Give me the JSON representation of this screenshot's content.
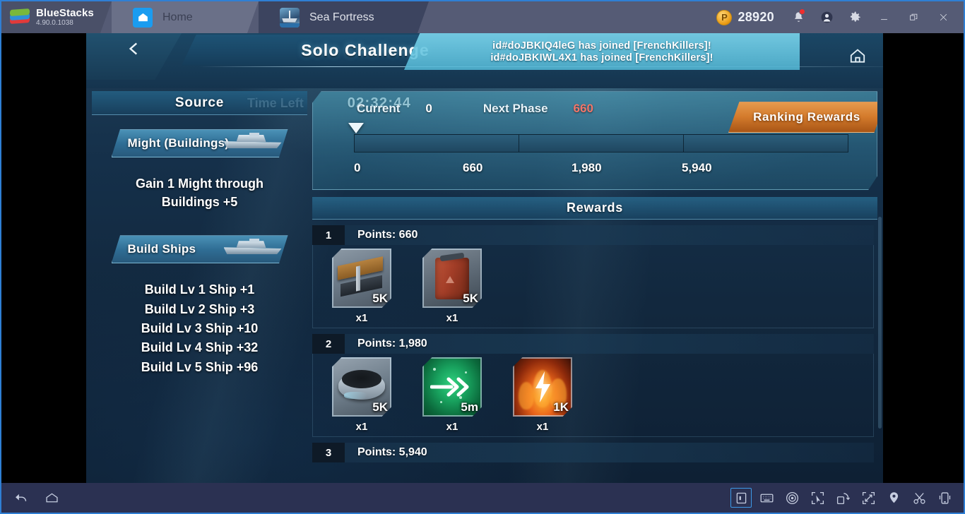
{
  "titlebar": {
    "brand_name": "BlueStacks",
    "brand_version": "4.90.0.1038",
    "tabs": [
      {
        "label": "Home",
        "icon": "home-icon"
      },
      {
        "label": "Sea Fortress",
        "icon": "game-icon"
      }
    ],
    "points_symbol": "P",
    "points_value": "28920",
    "buttons": [
      "notifications-bell",
      "user-avatar",
      "settings-gear",
      "minimize",
      "restore",
      "close"
    ]
  },
  "game": {
    "header": {
      "back_icon": "back-chevron-icon",
      "title": "Solo Challenge",
      "time_left_label": "Time Left",
      "time_left_value": "02:32:44",
      "home_icon": "home-icon",
      "chat": [
        "id#doJBKIQ4leG has joined [FrenchKillers]!",
        "id#doJBKIWL4X1 has joined [FrenchKillers]!"
      ]
    },
    "source": {
      "header": "Source",
      "sections": [
        {
          "tab_label": "Might (Buildings)",
          "lines": [
            "Gain 1 Might through",
            "Buildings +5"
          ]
        },
        {
          "tab_label": "Build Ships",
          "lines": [
            "Build Lv 1 Ship +1",
            "Build Lv 2 Ship +3",
            "Build Lv 3 Ship +10",
            "Build Lv 4 Ship +32",
            "Build Lv 5 Ship +96"
          ]
        }
      ]
    },
    "progress": {
      "current_label": "Current",
      "current_value": "0",
      "next_phase_label": "Next Phase",
      "next_phase_value": "660",
      "next_phase_color": "#f2766a",
      "ticks": [
        "0",
        "660",
        "1,980",
        "5,940"
      ],
      "marker_percent": 0
    },
    "ranking_button": "Ranking Rewards",
    "rewards": {
      "header": "Rewards",
      "tiers": [
        {
          "number": "1",
          "points_label": "Points: 660",
          "items": [
            {
              "art": "steel",
              "qty_badge": "5K",
              "count": "x1",
              "icon": "steel-beam-icon"
            },
            {
              "art": "fuel",
              "qty_badge": "5K",
              "count": "x1",
              "icon": "fuel-canister-icon"
            }
          ]
        },
        {
          "number": "2",
          "points_label": "Points: 1,980",
          "items": [
            {
              "art": "titan",
              "qty_badge": "5K",
              "count": "x1",
              "icon": "titanium-icon"
            },
            {
              "art": "speed",
              "qty_badge": "5m",
              "count": "x1",
              "icon": "speedup-arrows-icon"
            },
            {
              "art": "fire",
              "qty_badge": "1K",
              "count": "x1",
              "icon": "energy-flame-icon"
            }
          ]
        },
        {
          "number": "3",
          "points_label": "Points: 5,940",
          "items": []
        }
      ]
    }
  },
  "bottombar": {
    "left": [
      "back-icon",
      "home-icon"
    ],
    "right": [
      "sidebar-toggle-icon",
      "keyboard-icon",
      "eye-macro-icon",
      "pointer-select-icon",
      "rotate-screen-icon",
      "fullscreen-icon",
      "location-pin-icon",
      "scissors-cut-icon",
      "shake-device-icon"
    ]
  }
}
